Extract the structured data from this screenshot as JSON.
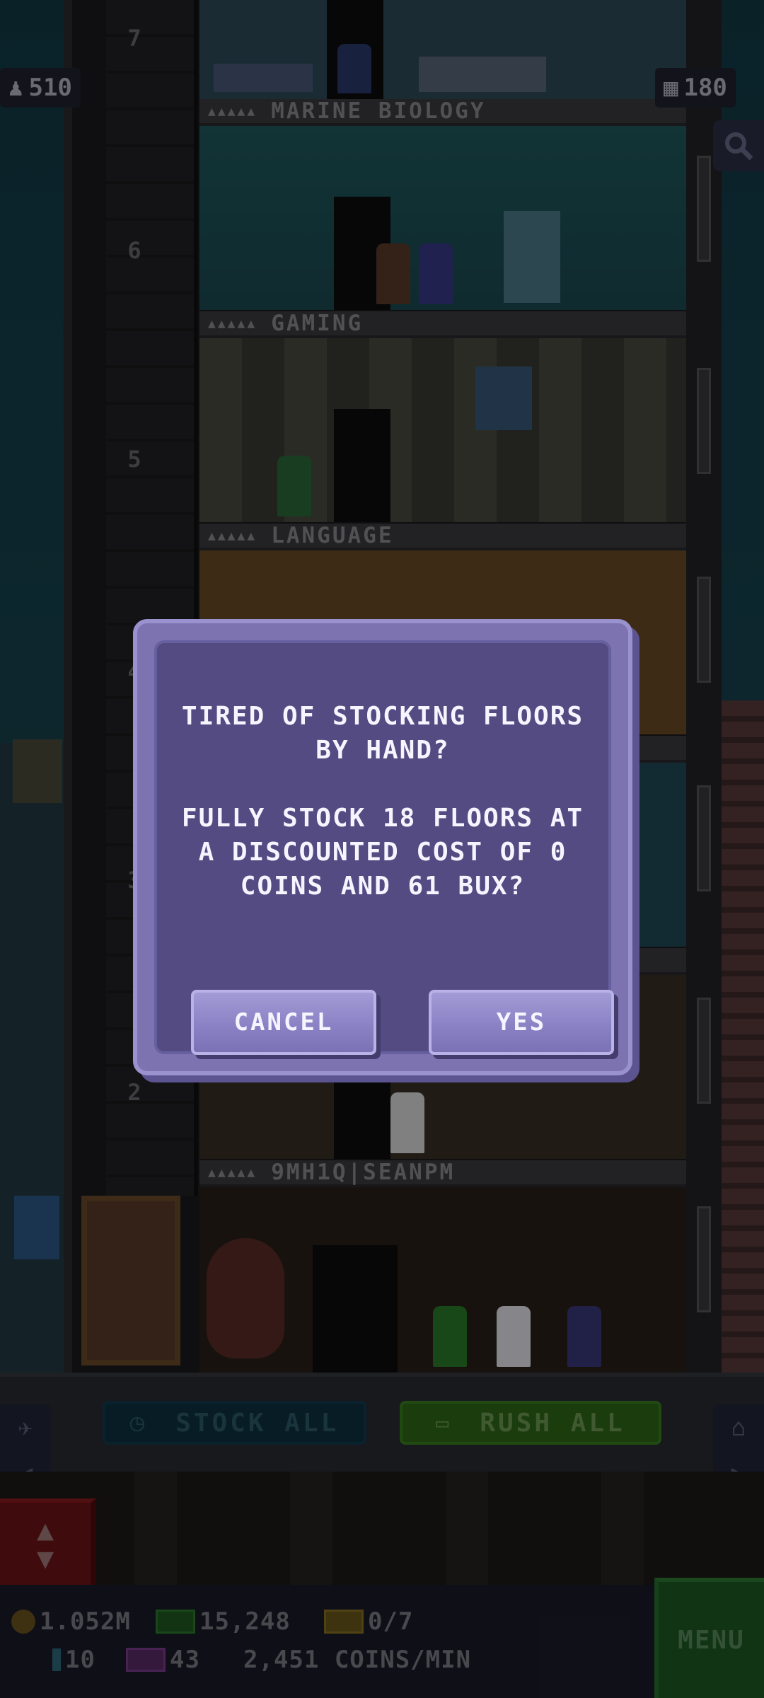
{
  "top_bar": {
    "population": "510",
    "floor_count": "180"
  },
  "floors": [
    {
      "number": "7",
      "name": ""
    },
    {
      "number": "6",
      "name": "MARINE BIOLOGY"
    },
    {
      "number": "5",
      "name": "GAMING"
    },
    {
      "number": "4",
      "name": "LANGUAGE"
    },
    {
      "number": "3",
      "name": ""
    },
    {
      "number": "2",
      "name": ""
    },
    {
      "number": "",
      "name": "9MH1Q|SEANPM"
    }
  ],
  "dialog": {
    "message": "TIRED OF STOCKING FLOORS\nBY HAND?\n\nFULLY STOCK 18 FLOORS AT\nA DISCOUNTED COST OF 0\nCOINS AND 61 BUX?",
    "cancel_label": "CANCEL",
    "yes_label": "YES"
  },
  "actions": {
    "stock_all_label": "STOCK ALL",
    "rush_all_label": "RUSH ALL"
  },
  "status": {
    "coins": "1.052M",
    "bux": "15,248",
    "tickets": "0/7",
    "bitizens": "10",
    "tv": "43",
    "coins_per_min": "2,451 COINS/MIN"
  },
  "menu_label": "MENU",
  "colors": {
    "dialog_bg": "#534b81",
    "dialog_border": "#7c73b0",
    "button": "#8a82c4",
    "menu_green": "#1d5a24",
    "elevator_red": "#6e1416"
  },
  "icons": [
    "person-icon",
    "building-icon",
    "search-icon",
    "clock-icon",
    "ticket-icon",
    "airplane-icon",
    "home-icon",
    "arrow-up-icon",
    "arrow-down-icon",
    "coin-icon",
    "bill-icon"
  ]
}
